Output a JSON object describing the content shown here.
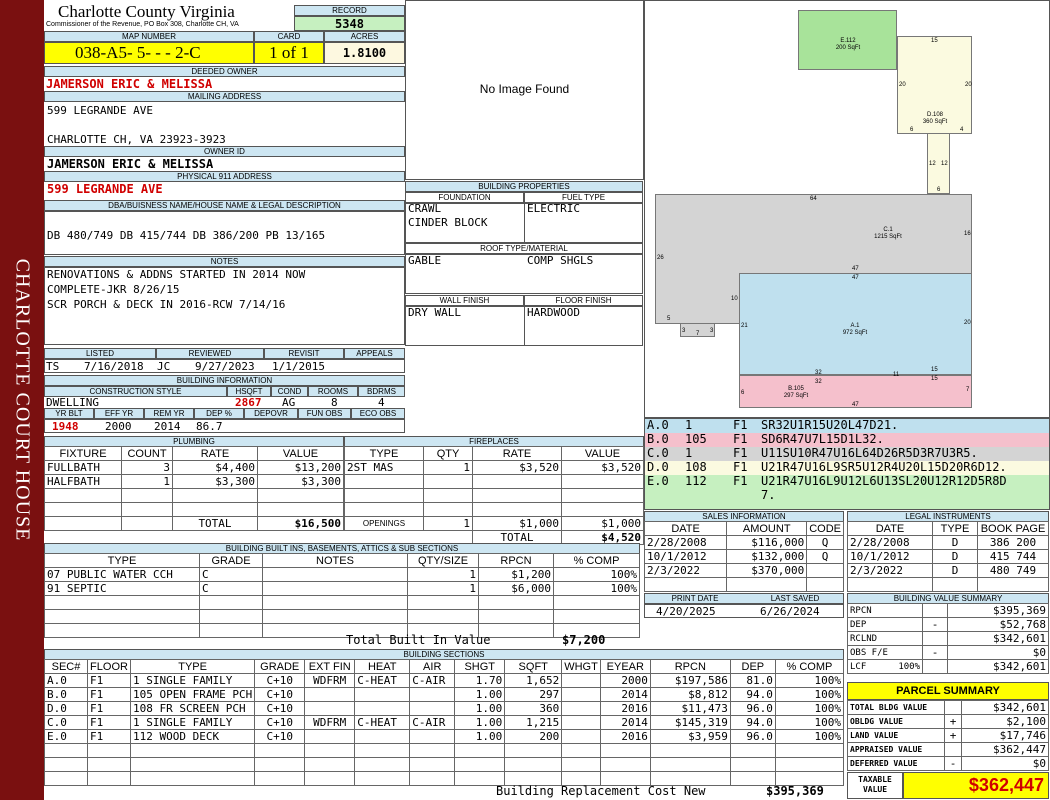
{
  "county": {
    "title": "Charlotte County Virginia",
    "subtitle": "Commissioner of the Revenue, PO Box 308, Charlotte CH, VA",
    "sidebar": "CHARLOTTE COURT HOUSE"
  },
  "record": {
    "label": "RECORD",
    "value": "5348"
  },
  "map": {
    "label": "MAP NUMBER",
    "value": "038-A5- 5-  -  -  2-C",
    "card_label": "CARD",
    "card": "1 of 1",
    "acres_label": "ACRES",
    "acres": "1.8100"
  },
  "owner": {
    "deeded_label": "DEEDED OWNER",
    "deeded": "JAMERSON ERIC & MELISSA",
    "mailing_label": "MAILING ADDRESS",
    "mail1": "599 LEGRANDE AVE",
    "mail2": "CHARLOTTE CH, VA 23923-3923",
    "ownerid_label": "OWNER ID",
    "ownerid": "JAMERSON ERIC & MELISSA",
    "phys_label": "PHYSICAL 911 ADDRESS",
    "phys": "599 LEGRANDE AVE"
  },
  "legal": {
    "label": "DBA/BUISNESS NAME/HOUSE NAME & LEGAL DESCRIPTION",
    "text": "DB 480/749 DB 415/744 DB 386/200 PB 13/165"
  },
  "notes": {
    "label": "NOTES",
    "l1": "RENOVATIONS & ADDNS STARTED IN 2014 NOW",
    "l2": "COMPLETE-JKR 8/26/15",
    "l3": "SCR PORCH & DECK IN 2016-RCW 7/14/16"
  },
  "dates": {
    "listed_label": "LISTED",
    "reviewed_label": "REVIEWED",
    "revisit_label": "REVISIT",
    "appeals_label": "APPEALS",
    "listed_by": "TS",
    "listed": "7/16/2018",
    "reviewed_by": "JC",
    "reviewed": "9/27/2023",
    "revisit": "1/1/2015"
  },
  "bldg_info": {
    "label": "BUILDING INFORMATION",
    "style_label": "CONSTRUCTION STYLE",
    "hsqft_label": "HSQFT",
    "cond_label": "COND",
    "rooms_label": "ROOMS",
    "bdrms_label": "BDRMS",
    "style": "DWELLING",
    "hsqft": "2867",
    "cond": "AG",
    "rooms": "8",
    "bdrms": "4",
    "yrblt_label": "YR BLT",
    "effyr_label": "EFF YR",
    "remyr_label": "REM YR",
    "dep_label": "DEP %",
    "depovr_label": "DEPOVR",
    "funobs_label": "FUN OBS",
    "ecoobs_label": "ECO OBS",
    "yrblt": "1948",
    "effyr": "2000",
    "remyr": "2014",
    "dep": "86.7"
  },
  "image": {
    "text": "No Image Found"
  },
  "props": {
    "label": "BUILDING PROPERTIES",
    "foundation_label": "FOUNDATION",
    "fuel_label": "FUEL TYPE",
    "foundation1": "CRAWL",
    "foundation2": "CINDER BLOCK",
    "fuel": "ELECTRIC",
    "roof_label": "ROOF TYPE/MATERIAL",
    "roof_type": "GABLE",
    "roof_mat": "COMP SHGLS",
    "wall_label": "WALL FINISH",
    "floor_label": "FLOOR FINISH",
    "wall": "DRY WALL",
    "floor": "HARDWOOD"
  },
  "sketch": {
    "labels": [
      {
        "id": "E.112",
        "sqft": "200 SqFt"
      },
      {
        "id": "D.108",
        "sqft": "360 SqFt"
      },
      {
        "id": "C.1",
        "sqft": "1215 SqFt"
      },
      {
        "id": "A.1",
        "sqft": "972 SqFt"
      },
      {
        "id": "B.105",
        "sqft": "297 SqFt"
      }
    ],
    "dims": [
      "15",
      "20",
      "20",
      "6",
      "4",
      "12",
      "12",
      "6",
      "64",
      "16",
      "26",
      "47",
      "47",
      "10",
      "21",
      "20",
      "5",
      "3",
      "7",
      "3",
      "32",
      "32",
      "15",
      "15",
      "6",
      "7",
      "47",
      "11"
    ],
    "vectors": [
      {
        "code": "A.0",
        "n": "1",
        "fl": "F1",
        "v": "SR32U1R15U20L47D21.",
        "color": "#bfe0ee"
      },
      {
        "code": "B.0",
        "n": "105",
        "fl": "F1",
        "v": "SD6R47U7L15D1L32.",
        "color": "#f5c0cc"
      },
      {
        "code": "C.0",
        "n": "1",
        "fl": "F1",
        "v": "U11SU10R47U16L64D26R5D3R7U3R5.",
        "color": "#d4d4d4"
      },
      {
        "code": "D.0",
        "n": "108",
        "fl": "F1",
        "v": "U21R47U16L9SR5U12R4U20L15D20R6D12.",
        "color": "#fbfae0"
      },
      {
        "code": "E.0",
        "n": "112",
        "fl": "F1",
        "v": "U21R47U16L9U12L6U13SL20U12R12D5R8D",
        "v2": "7.",
        "color": "#c6f0c0"
      }
    ]
  },
  "plumbing": {
    "label": "PLUMBING",
    "h_fixture": "FIXTURE",
    "h_count": "COUNT",
    "h_rate": "RATE",
    "h_value": "VALUE",
    "rows": [
      {
        "fixture": "FULLBATH",
        "count": "3",
        "rate": "$4,400",
        "value": "$13,200"
      },
      {
        "fixture": "HALFBATH",
        "count": "1",
        "rate": "$3,300",
        "value": "$3,300"
      }
    ],
    "total_label": "TOTAL",
    "total": "$16,500"
  },
  "fireplaces": {
    "label": "FIREPLACES",
    "h_type": "TYPE",
    "h_qty": "QTY",
    "h_rate": "RATE",
    "h_value": "VALUE",
    "type": "2ST MAS",
    "qty": "1",
    "rate": "$3,520",
    "value": "$3,520",
    "openings_label": "OPENINGS",
    "op_qty": "1",
    "op_rate": "$1,000",
    "op_value": "$1,000",
    "total_label": "TOTAL",
    "total": "$4,520"
  },
  "sales": {
    "label": "SALES INFORMATION",
    "h_date": "DATE",
    "h_amount": "AMOUNT",
    "h_code": "CODE",
    "rows": [
      {
        "date": "2/28/2008",
        "amount": "$116,000",
        "code": "Q"
      },
      {
        "date": "10/1/2012",
        "amount": "$132,000",
        "code": "Q"
      },
      {
        "date": "2/3/2022",
        "amount": "$370,000",
        "code": ""
      }
    ]
  },
  "legal_inst": {
    "label": "LEGAL INSTRUMENTS",
    "h_date": "DATE",
    "h_type": "TYPE",
    "h_book": "BOOK PAGE",
    "rows": [
      {
        "date": "2/28/2008",
        "type": "D",
        "book": "386 200"
      },
      {
        "date": "10/1/2012",
        "type": "D",
        "book": "415 744"
      },
      {
        "date": "2/3/2022",
        "type": "D",
        "book": "480 749"
      }
    ]
  },
  "builtins": {
    "label": "BUILDING BUILT INS, BASEMENTS, ATTICS & SUB SECTIONS",
    "h_type": "TYPE",
    "h_grade": "GRADE",
    "h_notes": "NOTES",
    "h_qty": "QTY/SIZE",
    "h_rpcn": "RPCN",
    "h_comp": "% COMP",
    "rows": [
      {
        "type": "07 PUBLIC WATER CCH",
        "grade": "C",
        "qty": "1",
        "rpcn": "$1,200",
        "comp": "100%"
      },
      {
        "type": "91 SEPTIC",
        "grade": "C",
        "qty": "1",
        "rpcn": "$6,000",
        "comp": "100%"
      }
    ],
    "total_label": "Total Built In Value",
    "total": "$7,200"
  },
  "print": {
    "print_label": "PRINT DATE",
    "saved_label": "LAST SAVED",
    "print": "4/20/2025",
    "saved": "6/26/2024"
  },
  "bvs": {
    "label": "BUILDING VALUE SUMMARY",
    "rows": [
      {
        "k": "RPCN",
        "s": "",
        "v": "$395,369"
      },
      {
        "k": "DEP",
        "s": "-",
        "v": "$52,768"
      },
      {
        "k": "RCLND",
        "s": "",
        "v": "$342,601"
      },
      {
        "k": "OBS F/E",
        "s": "-",
        "v": "$0"
      },
      {
        "k": "LCF",
        "pct": "100%",
        "s": "",
        "v": "$342,601"
      }
    ]
  },
  "summary": {
    "label": "PARCEL SUMMARY",
    "rows": [
      {
        "k": "TOTAL BLDG VALUE",
        "s": "",
        "v": "$342,601"
      },
      {
        "k": "OBLDG VALUE",
        "s": "+",
        "v": "$2,100"
      },
      {
        "k": "LAND VALUE",
        "s": "+",
        "v": "$17,746"
      },
      {
        "k": "APPRAISED VALUE",
        "s": "",
        "v": "$362,447"
      },
      {
        "k": "DEFERRED VALUE",
        "s": "-",
        "v": "$0"
      }
    ],
    "taxable_label": "TAXABLE VALUE",
    "taxable": "$362,447"
  },
  "sections": {
    "label": "BUILDING SECTIONS",
    "headers": [
      "SEC#",
      "FLOOR",
      "TYPE",
      "GRADE",
      "EXT FIN",
      "HEAT",
      "AIR",
      "SHGT",
      "SQFT",
      "WHGT",
      "EYEAR",
      "RPCN",
      "DEP",
      "% COMP"
    ],
    "rows": [
      [
        "A.0",
        "F1",
        "1 SINGLE FAMILY",
        "C+10",
        "WDFRM",
        "C-HEAT",
        "C-AIR",
        "1.70",
        "1,652",
        "",
        "2000",
        "$197,586",
        "81.0",
        "100%"
      ],
      [
        "B.0",
        "F1",
        "105 OPEN FRAME PCH",
        "C+10",
        "",
        "",
        "",
        "1.00",
        "297",
        "",
        "2014",
        "$8,812",
        "94.0",
        "100%"
      ],
      [
        "D.0",
        "F1",
        "108 FR SCREEN PCH",
        "C+10",
        "",
        "",
        "",
        "1.00",
        "360",
        "",
        "2016",
        "$11,473",
        "96.0",
        "100%"
      ],
      [
        "C.0",
        "F1",
        "1 SINGLE FAMILY",
        "C+10",
        "WDFRM",
        "C-HEAT",
        "C-AIR",
        "1.00",
        "1,215",
        "",
        "2014",
        "$145,319",
        "94.0",
        "100%"
      ],
      [
        "E.0",
        "F1",
        "112 WOOD DECK",
        "C+10",
        "",
        "",
        "",
        "1.00",
        "200",
        "",
        "2016",
        "$3,959",
        "96.0",
        "100%"
      ]
    ],
    "brcn_label": "Building Replacement Cost New",
    "brcn": "$395,369"
  },
  "colors": {
    "sidebar": "#7a1010",
    "header": "#cde6f2",
    "yellow": "#ffff00",
    "green": "#c6f0c0",
    "red": "#d00000"
  }
}
